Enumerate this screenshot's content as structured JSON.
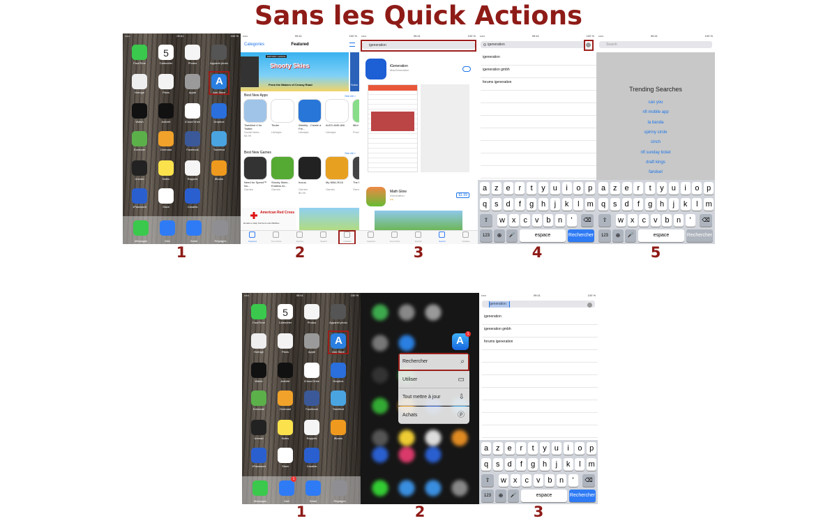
{
  "title": "Sans les Quick Actions",
  "numbers_top": [
    "1",
    "2",
    "3",
    "4",
    "5"
  ],
  "numbers_bottom": [
    "1",
    "2",
    "3"
  ],
  "status": {
    "carrier": "•••••",
    "time": "09:41",
    "battery": "100 %"
  },
  "home": {
    "apps": [
      "FaceTime",
      "Calendrier",
      "Photos",
      "Appareil photo",
      "Horloge",
      "Plans",
      "Apple",
      "App Store",
      "Watch",
      "Activité",
      "iCloud Drive",
      "Dropbox",
      "Evernote",
      "Overcast",
      "Facebook",
      "Tweetbot",
      "Unread",
      "Notes",
      "Rappels",
      "iBooks",
      "1Password",
      "Slack",
      "Canabis"
    ],
    "calendar_day": "5",
    "dock": [
      "Messages",
      "Mail",
      "Safari",
      "Réglages"
    ],
    "badge": "1"
  },
  "featured": {
    "header": "Featured",
    "categories": "Categories",
    "banner_editor": "EDITORS' CHOICE",
    "banner_game": "Shooty Skies",
    "banner_sub": "From the Makers of Crossy Road",
    "banner_cut": "Subw",
    "sec1": "Best New Apps",
    "sec2": "Best New Games",
    "see_all": "See All >",
    "apps1": [
      {
        "n": "Tweetbot 4 for Twitter",
        "c": "Social Netw...",
        "p": "$4.99"
      },
      {
        "n": "Tinder",
        "c": "Lifestyle",
        "p": ""
      },
      {
        "n": "Weebly - Create a Fre...",
        "c": "Lifestyle",
        "p": ""
      },
      {
        "n": "ALEX AND ANI",
        "c": "Lifestyle",
        "p": ""
      },
      {
        "n": "Mint Del...",
        "c": "Prod...",
        "p": ""
      }
    ],
    "apps2": [
      {
        "n": "Need for Speed™ No...",
        "c": "Games",
        "p": ""
      },
      {
        "n": "Shooty Skies - Endless Ar...",
        "c": "Games",
        "p": ""
      },
      {
        "n": "hocus.",
        "c": "Games",
        "p": "$0.99"
      },
      {
        "n": "My NBA 2K16",
        "c": "Games",
        "p": ""
      },
      {
        "n": "The Fri...",
        "c": "Games",
        "p": ""
      }
    ],
    "ad1": "American Red Cross",
    "ad2": "Donate to Help Survivors and Wildfires",
    "tabs": [
      "Featured",
      "Top Charts",
      "Explore",
      "Search",
      "Updates"
    ]
  },
  "search3": {
    "query": "igeneration",
    "r1": "iGeneration",
    "r1sub": "MacGeneration",
    "r2": "Math Glow",
    "r2sub": "iGeneration",
    "price": "$1.99",
    "r2rate": "(11)"
  },
  "search4": {
    "query": "igeneration",
    "suggestions": [
      "igeneration",
      "igeneration gmbh",
      "forums igeneration"
    ]
  },
  "search5": {
    "placeholder": "Search",
    "trending_title": "Trending Searches",
    "trending": [
      "can you",
      "nfl mobile app",
      "la banda",
      "spinny circle",
      "cinch",
      "nfl sunday ticket",
      "draft kings",
      "fanduel"
    ]
  },
  "keyboard": {
    "row1": [
      "a",
      "z",
      "e",
      "r",
      "t",
      "y",
      "u",
      "i",
      "o",
      "p"
    ],
    "row2": [
      "q",
      "s",
      "d",
      "f",
      "g",
      "h",
      "j",
      "k",
      "l",
      "m"
    ],
    "row3": [
      "w",
      "x",
      "c",
      "v",
      "b",
      "n",
      "'"
    ],
    "n123": "123",
    "space": "espace",
    "search": "Rechercher"
  },
  "quick": {
    "items": [
      "Rechercher",
      "Utiliser",
      "Tout mettre à jour",
      "Achats"
    ],
    "badge": "1"
  },
  "search_b3": {
    "query": "igeneration",
    "suggestions": [
      "igeneration",
      "igeneration gmbh",
      "forums igeneration"
    ]
  },
  "colors": {
    "accent": "#8e1b17",
    "ios_blue": "#2f7bf5"
  }
}
